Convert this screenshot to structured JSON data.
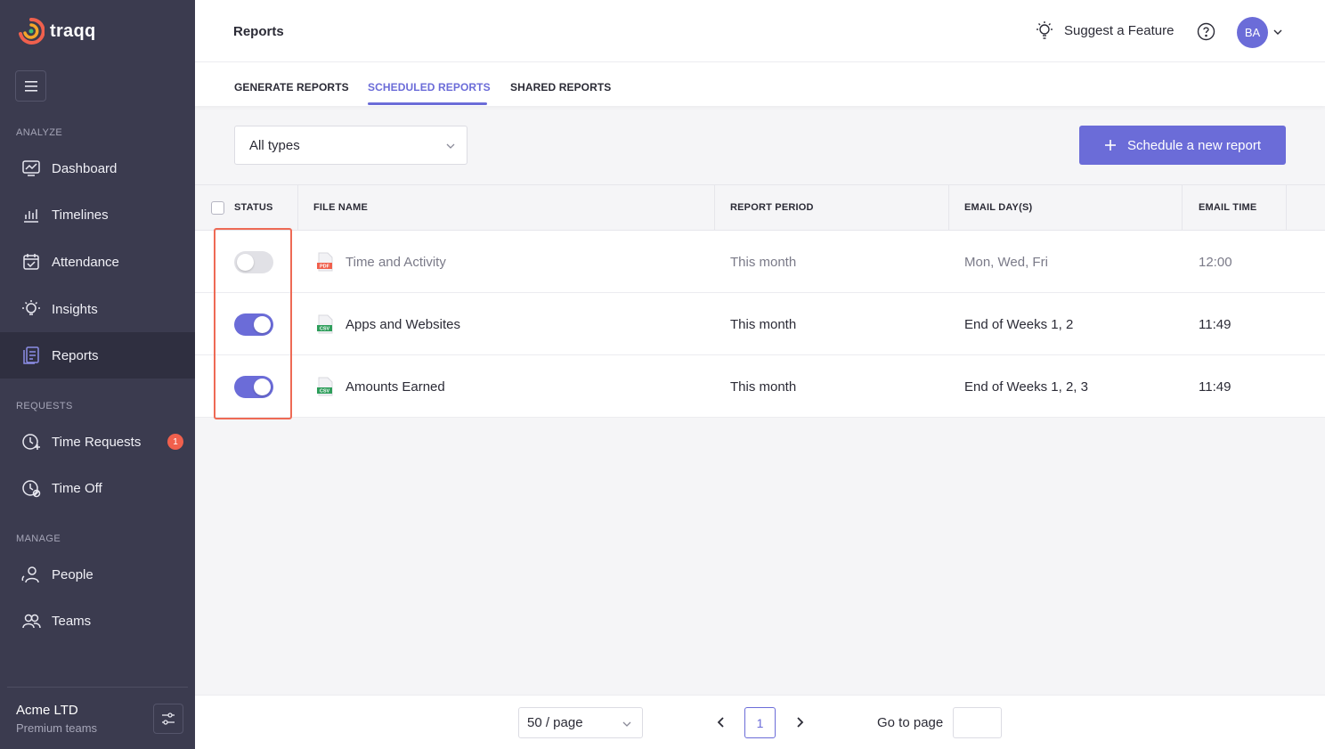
{
  "brand": {
    "name": "traqq"
  },
  "sidebar": {
    "sections": {
      "analyze": "ANALYZE",
      "requests": "REQUESTS",
      "manage": "MANAGE"
    },
    "items": [
      {
        "label": "Dashboard",
        "icon": "dashboard-icon"
      },
      {
        "label": "Timelines",
        "icon": "timelines-icon"
      },
      {
        "label": "Attendance",
        "icon": "attendance-icon"
      },
      {
        "label": "Insights",
        "icon": "insights-icon"
      },
      {
        "label": "Reports",
        "icon": "reports-icon",
        "active": true
      },
      {
        "label": "Time Requests",
        "icon": "time-requests-icon",
        "badge": "1"
      },
      {
        "label": "Time Off",
        "icon": "time-off-icon"
      },
      {
        "label": "People",
        "icon": "people-icon"
      },
      {
        "label": "Teams",
        "icon": "teams-icon"
      }
    ],
    "footer": {
      "company": "Acme LTD",
      "plan": "Premium teams"
    }
  },
  "header": {
    "title": "Reports",
    "suggest": "Suggest a Feature",
    "avatar_initials": "BA"
  },
  "tabs": [
    {
      "label": "GENERATE REPORTS"
    },
    {
      "label": "SCHEDULED REPORTS",
      "active": true
    },
    {
      "label": "SHARED REPORTS"
    }
  ],
  "toolbar": {
    "type_filter": "All types",
    "schedule_button": "Schedule a new report"
  },
  "table": {
    "columns": [
      "STATUS",
      "FILE NAME",
      "REPORT PERIOD",
      "EMAIL DAY(S)",
      "EMAIL TIME"
    ],
    "rows": [
      {
        "enabled": false,
        "file_type": "PDF",
        "file_name": "Time and Activity",
        "period": "This month",
        "days": "Mon, Wed, Fri",
        "time": "12:00"
      },
      {
        "enabled": true,
        "file_type": "CSV",
        "file_name": "Apps and Websites",
        "period": "This month",
        "days": "End of Weeks 1, 2",
        "time": "11:49"
      },
      {
        "enabled": true,
        "file_type": "CSV",
        "file_name": "Amounts Earned",
        "period": "This month",
        "days": "End of Weeks 1, 2, 3",
        "time": "11:49"
      }
    ]
  },
  "pagination": {
    "per_page": "50 / page",
    "current_page": "1",
    "goto_label": "Go to page"
  },
  "colors": {
    "accent": "#6b6cd8",
    "sidebar": "#3b3b4f",
    "highlight": "#ee6a55",
    "pdf": "#f0604d",
    "csv": "#2e9e5b"
  }
}
